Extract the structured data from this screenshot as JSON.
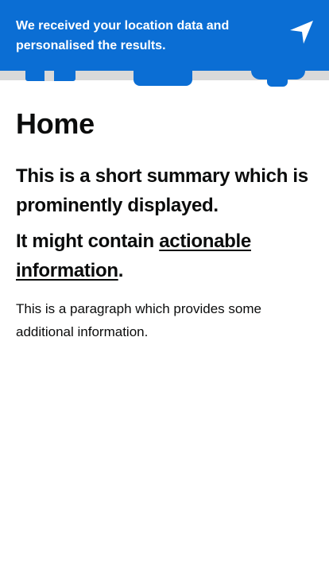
{
  "banner": {
    "message": "We received your location data and personalised the results.",
    "icon": "location-arrow-icon",
    "background_color": "#0b6ed4"
  },
  "page": {
    "title": "Home",
    "summary": "This is a short summary which is prominently displayed.",
    "action_prefix": "It might contain ",
    "action_link": "actionable information",
    "action_suffix": ".",
    "paragraph": "This is a paragraph which provides some additional information."
  }
}
